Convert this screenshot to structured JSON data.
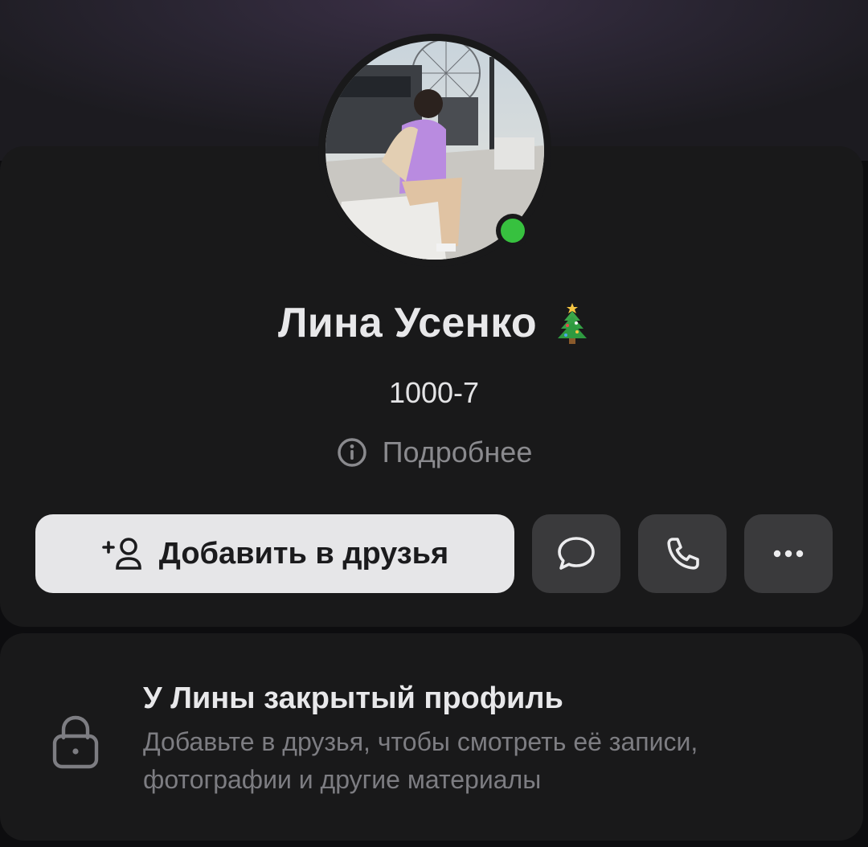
{
  "profile": {
    "name": "Лина Усенко",
    "status": "1000-7",
    "details_label": "Подробнее",
    "online": true
  },
  "actions": {
    "add_friend_label": "Добавить в друзья",
    "message_icon": "message-icon",
    "call_icon": "phone-icon",
    "more_icon": "more-icon"
  },
  "private_profile": {
    "title": "У Лины закрытый профиль",
    "text": "Добавьте в друзья, чтобы смотреть её записи, фотографии и другие материалы"
  },
  "colors": {
    "background": "#0d0d0f",
    "card": "#19191a",
    "online": "#37c13f",
    "primary_button": "#e6e6e8",
    "secondary_button": "#3a3a3c"
  }
}
